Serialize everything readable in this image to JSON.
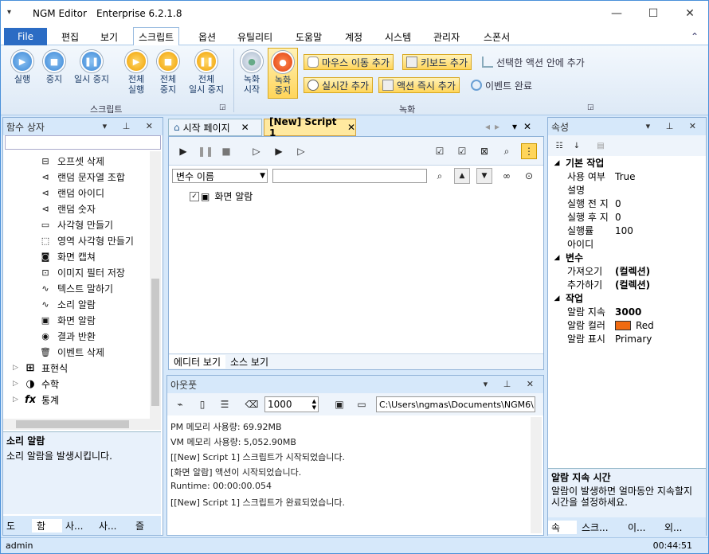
{
  "window": {
    "app_name": "NGM Editor",
    "edition": "Enterprise 6.2.1.8",
    "min": "—",
    "max": "☐",
    "close": "✕"
  },
  "menu": {
    "file": "File",
    "items": [
      "편집",
      "보기",
      "스크립트",
      "옵션",
      "유틸리티",
      "도움말",
      "계정",
      "시스템",
      "관리자",
      "스폰서"
    ]
  },
  "ribbon": {
    "script_group": "스크립트",
    "record_group": "녹화",
    "run": "실행",
    "stop": "중지",
    "pause": "일시 중지",
    "all_run_1": "전체",
    "all_run_2": "실행",
    "all_stop_1": "전체",
    "all_stop_2": "중지",
    "all_pause_1": "전체",
    "all_pause_2": "일시 중지",
    "rec_start_1": "녹화",
    "rec_start_2": "시작",
    "rec_stop_1": "녹화",
    "rec_stop_2": "중지",
    "mouse_move": "마우스 이동 추가",
    "keyboard": "키보드 추가",
    "add_in_selected": "선택한 액션 안에 추가",
    "add_realtime": "실시간 추가",
    "action_now": "액션 즉시 추가",
    "event_done": "이벤트 완료"
  },
  "toolbox": {
    "title": "함수 상자",
    "items": [
      "오프셋 삭제",
      "랜덤 문자열 조합",
      "랜덤 아이디",
      "랜덤 숫자",
      "사각형 만들기",
      "영역 사각형 만들기",
      "화면 캡쳐",
      "이미지 필터 저장",
      "텍스트 말하기",
      "소리 알람",
      "화면 알람",
      "결과 반환",
      "이벤트 삭제"
    ],
    "categories": [
      "표현식",
      "수학",
      "통계"
    ],
    "desc_title": "소리 알람",
    "desc_text": "소리 알람을 발생시킵니다.",
    "tabs": [
      "도",
      "함",
      "사...",
      "사...",
      "즐"
    ]
  },
  "editor": {
    "tab_start": "시작 페이지",
    "tab_script": "[New] Script 1",
    "var_placeholder": "변수 이름",
    "tree_item": "화면 알람",
    "view_editor": "에디터 보기",
    "view_source": "소스 보기"
  },
  "output": {
    "title": "아웃풋",
    "count": "1000",
    "path": "C:\\Users\\ngmas\\Documents\\NGM6\\",
    "lines": [
      "PM 메모리 사용량: 69.92MB",
      "VM 메모리 사용량: 5,052.90MB",
      "[[New] Script 1] 스크립트가 시작되었습니다.",
      "[화면 알람] 액션이 시작되었습니다.",
      "Runtime: 00:00:00.054",
      "[[New] Script 1] 스크립트가 완료되었습니다."
    ]
  },
  "props": {
    "title": "속성",
    "cat_basic": "기본 작업",
    "cat_var": "변수",
    "cat_work": "작업",
    "rows_basic": [
      {
        "k": "사용 여부",
        "v": "True"
      },
      {
        "k": "설명",
        "v": ""
      },
      {
        "k": "실행 전 지",
        "v": "0"
      },
      {
        "k": "실행 후 지",
        "v": "0"
      },
      {
        "k": "실행률",
        "v": "100"
      },
      {
        "k": "아이디",
        "v": ""
      }
    ],
    "rows_var": [
      {
        "k": "가져오기",
        "v": "(컬렉션)"
      },
      {
        "k": "추가하기",
        "v": "(컬렉션)"
      }
    ],
    "rows_work": [
      {
        "k": "알람 지속",
        "v": "3000"
      },
      {
        "k": "알람 컬러",
        "v": "Red"
      },
      {
        "k": "알람 표시",
        "v": "Primary"
      }
    ],
    "alarm_color": "#f06a10",
    "desc_title": "알람 지속 시간",
    "desc_text": "알람이 발생하면 얼마동안 지속할지 시간을 설정하세요.",
    "tabs": [
      "속",
      "스크...",
      "이...",
      "외..."
    ]
  },
  "status": {
    "user": "admin",
    "time": "00:44:51"
  }
}
